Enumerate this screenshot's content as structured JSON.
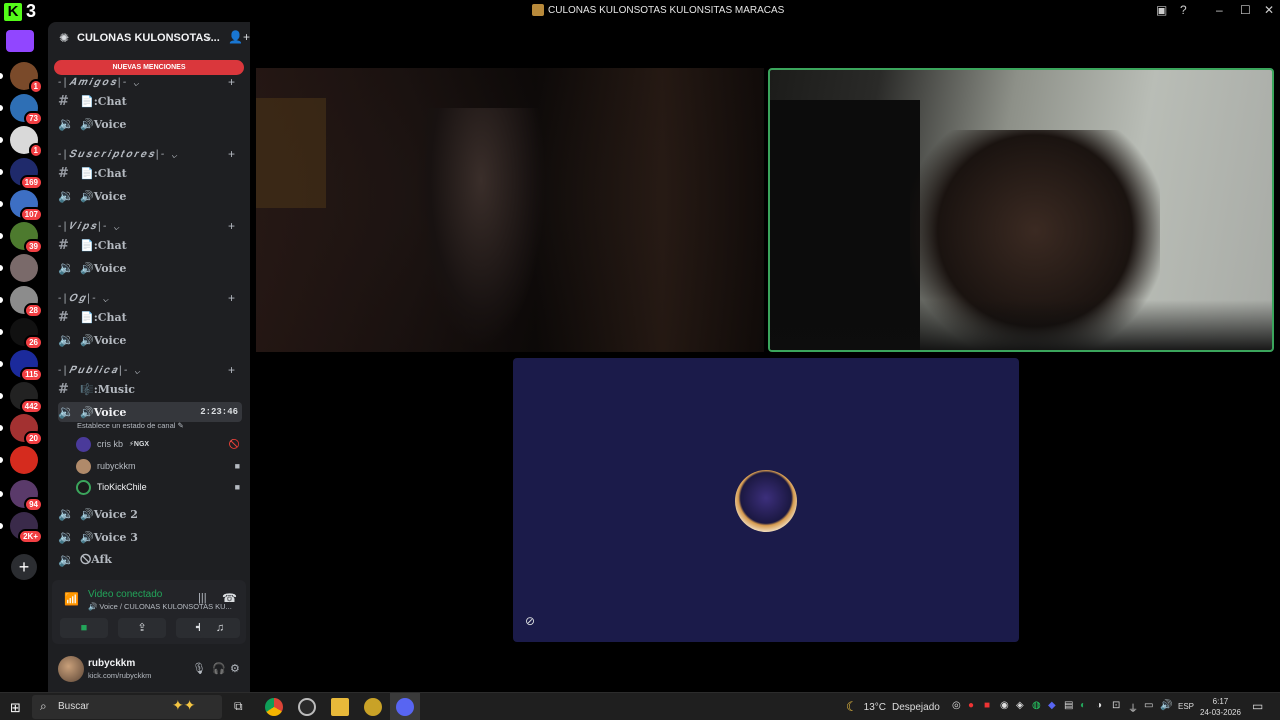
{
  "app": {
    "logo_letter": "K",
    "logo_number": "3",
    "window_title": "CULONAS KULONSOTAS KULONSITAS MARACAS"
  },
  "rail": {
    "servers": [
      {
        "name": "server-kubo",
        "badge": "1",
        "color": "#7a4a2a"
      },
      {
        "name": "server-blue",
        "badge": "73",
        "color": "#2e6fb5"
      },
      {
        "name": "server-white",
        "badge": "1",
        "color": "#d9d9d9"
      },
      {
        "name": "server-rocket",
        "badge": "169",
        "color": "#1f2a6b"
      },
      {
        "name": "server-cloud",
        "badge": "107",
        "color": "#3d6fc4"
      },
      {
        "name": "server-frog",
        "badge": "39",
        "color": "#4d7a2e"
      },
      {
        "name": "server-anime",
        "badge": "",
        "color": "#7a6a6a"
      },
      {
        "name": "server-grey",
        "badge": "28",
        "color": "#8c8c8c"
      },
      {
        "name": "server-tca",
        "badge": "26",
        "color": "#111111"
      },
      {
        "name": "server-sonic",
        "badge": "115",
        "color": "#1b2a9b"
      },
      {
        "name": "server-racing",
        "badge": "442",
        "color": "#222222"
      },
      {
        "name": "server-red",
        "badge": "20",
        "color": "#a33131"
      },
      {
        "name": "server-chile",
        "badge": "",
        "color": "#d52b1e"
      },
      {
        "name": "server-group",
        "badge": "94",
        "color": "#5a3a6a"
      },
      {
        "name": "server-multi",
        "badge": "2K+",
        "color": "#3a2a4a"
      }
    ]
  },
  "sidebar": {
    "server_name": "CULONAS KULONSOTAS...",
    "new_mentions": "NUEVAS MENCIONES",
    "categories": [
      {
        "label": "-|𝑨𝒎𝒊𝒈𝒐𝒔|-",
        "chat": "📄:Chat",
        "voice": "🔊Voice"
      },
      {
        "label": "-|𝑺𝒖𝒔𝒄𝒓𝒊𝒑𝒕𝒐𝒓𝒆𝒔|-",
        "chat": "📄:Chat",
        "voice": "🔊Voice"
      },
      {
        "label": "-|𝑽𝒊𝒑𝒔|-",
        "chat": "📄:Chat",
        "voice": "🔊Voice"
      },
      {
        "label": "-|𝑶𝒈|-",
        "chat": "📄:Chat",
        "voice": "🔊Voice"
      },
      {
        "label": "-|𝑷𝒖𝒃𝒍𝒊𝒄𝒂|-",
        "music": "🎼:Music",
        "voice": "🔊Voice",
        "voice2": "🔊Voice 2",
        "voice3": "🔊Voice 3",
        "afk": "🛇Afk"
      }
    ],
    "active_timer": "2:23:46",
    "channel_status": "Establece un estado de canal",
    "voice_users": [
      {
        "name": "cris kb",
        "tag": "⚡NGX",
        "icon": "muted"
      },
      {
        "name": "rubyckkm",
        "tag": "",
        "icon": "camera"
      },
      {
        "name": "TioKickChile",
        "tag": "",
        "icon": "camera"
      }
    ],
    "voice_connected": {
      "title": "Video conectado",
      "subtitle": "🔊 Voice / CULONAS KULONSOTAS KU..."
    },
    "user": {
      "name": "rubyckkm",
      "status": "kick.com/rubyckkm"
    }
  },
  "taskbar": {
    "search_placeholder": "Buscar",
    "weather": {
      "temp": "13°C",
      "desc": "Despejado"
    },
    "lang": "ESP",
    "time": "6:17",
    "date": "24-03-2026"
  }
}
